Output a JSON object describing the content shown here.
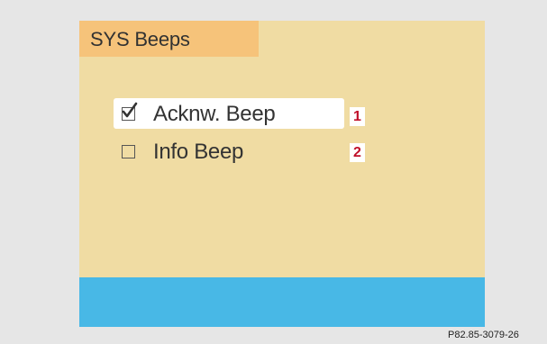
{
  "menu": {
    "title": "SYS Beeps",
    "options": [
      {
        "label": "Ackn​w. Beep",
        "checked": true,
        "selected": true,
        "marker": "1"
      },
      {
        "label": "Info Beep",
        "checked": false,
        "selected": false,
        "marker": "2"
      }
    ]
  },
  "footer": {
    "reference": "P82.85-3079-26"
  },
  "colors": {
    "background": "#e6e6e6",
    "panel": "#f0dca3",
    "title_tab": "#f6c37a",
    "bottom_bar": "#48b8e6",
    "marker_text": "#c0102a",
    "highlight": "#ffffff"
  },
  "icons": {
    "checked": "checkmark-icon",
    "unchecked": "empty-checkbox-icon"
  }
}
